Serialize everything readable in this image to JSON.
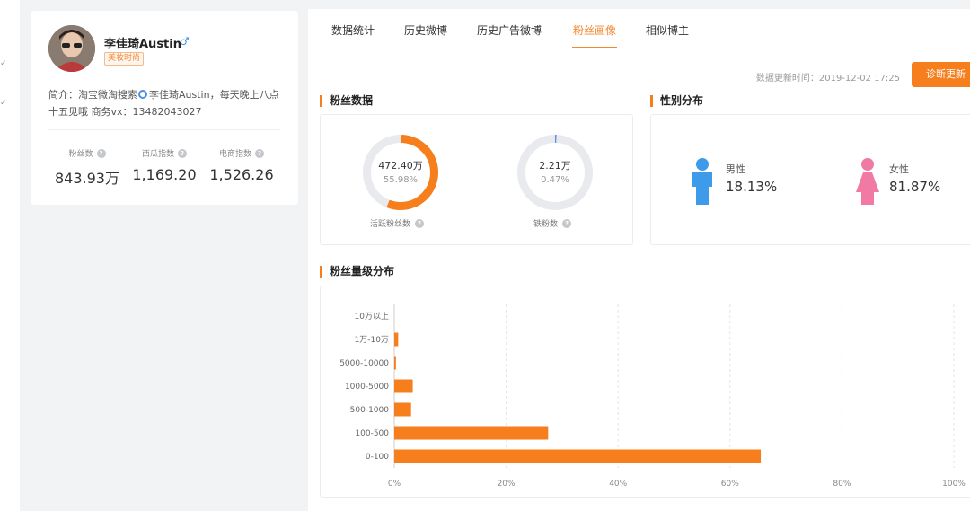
{
  "profile": {
    "name": "李佳琦Austin",
    "gender_symbol": "♂",
    "tag": "美妆时尚",
    "bio_line1_a": "简介：淘宝微淘搜索",
    "bio_line1_b": "李佳琦Austin，每天晚上八点",
    "bio_line2": "十五见哦 商务vx：13482043027",
    "stats": [
      {
        "label": "粉丝数",
        "value": "843.93万"
      },
      {
        "label": "西瓜指数",
        "value": "1,169.20"
      },
      {
        "label": "电商指数",
        "value": "1,526.26"
      }
    ]
  },
  "tabs": [
    "数据统计",
    "历史微博",
    "历史广告微博",
    "粉丝画像",
    "相似博主"
  ],
  "active_tab": "粉丝画像",
  "update_time": "数据更新时间：2019-12-02 17:25",
  "diagnose_button": "诊断更新",
  "fans_section": {
    "title": "粉丝数据",
    "active": {
      "count": "472.40万",
      "percent": "55.98%",
      "fraction": 0.5598,
      "label": "活跃粉丝数"
    },
    "iron": {
      "count": "2.21万",
      "percent": "0.47%",
      "fraction": 0.0047,
      "label": "铁粉数"
    }
  },
  "gender_section": {
    "title": "性别分布",
    "male": {
      "label": "男性",
      "value": "18.13%"
    },
    "female": {
      "label": "女性",
      "value": "81.87%"
    }
  },
  "colors": {
    "accent": "#f77e1d",
    "male": "#3d9be9",
    "female": "#f07aa4",
    "track": "#e8eaed"
  },
  "chart_data": {
    "type": "bar",
    "orientation": "horizontal",
    "title": "粉丝量级分布",
    "categories": [
      "10万以上",
      "1万-10万",
      "5000-10000",
      "1000-5000",
      "500-1000",
      "100-500",
      "0-100"
    ],
    "values": [
      0,
      0.7,
      0.3,
      3.3,
      3.0,
      27.5,
      65.5
    ],
    "xlim": [
      0,
      100
    ],
    "xticks": [
      "0%",
      "20%",
      "40%",
      "60%",
      "80%",
      "100%"
    ],
    "grid": true
  }
}
